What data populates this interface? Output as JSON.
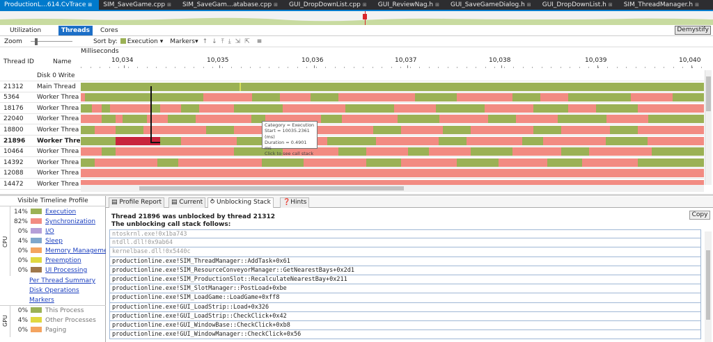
{
  "doc_tabs": [
    {
      "label": "ProductionL…614.CvTrace",
      "active": true
    },
    {
      "label": "SIM_SaveGame.cpp",
      "active": false
    },
    {
      "label": "SIM_SaveGam…atabase.cpp",
      "active": false
    },
    {
      "label": "GUI_DropDownList.cpp",
      "active": false
    },
    {
      "label": "GUI_ReviewNag.h",
      "active": false
    },
    {
      "label": "GUI_SaveGameDialog.h",
      "active": false
    },
    {
      "label": "GUI_DropDownList.h",
      "active": false
    },
    {
      "label": "SIM_ThreadManager.h",
      "active": false
    }
  ],
  "view_tabs": {
    "utilization": "Utilization",
    "threads": "Threads",
    "cores": "Cores",
    "demystify": "Demystify"
  },
  "toolbar": {
    "zoom": "Zoom",
    "sort_by": "Sort by:",
    "sort_value": "Execution",
    "markers": "Markers",
    "zoom_level": 0.1
  },
  "timeline": {
    "unit_label": "Milliseconds",
    "col_thread": "Thread ID",
    "col_name": "Name",
    "ticks": [
      "10,034",
      "10,035",
      "10,036",
      "10,037",
      "10,038",
      "10,039",
      "10,040"
    ]
  },
  "threads": [
    {
      "id": "",
      "name": "Disk 0 Write",
      "bold": false
    },
    {
      "id": "21312",
      "name": "Main Thread",
      "bold": false
    },
    {
      "id": "5364",
      "name": "Worker Threa",
      "bold": false
    },
    {
      "id": "18176",
      "name": "Worker Threa",
      "bold": false
    },
    {
      "id": "22040",
      "name": "Worker Threa",
      "bold": false
    },
    {
      "id": "18800",
      "name": "Worker Threa",
      "bold": false
    },
    {
      "id": "21896",
      "name": "Worker Threa",
      "bold": true
    },
    {
      "id": "10464",
      "name": "Worker Threa",
      "bold": false
    },
    {
      "id": "14392",
      "name": "Worker Threa",
      "bold": false
    },
    {
      "id": "12088",
      "name": "Worker Threa",
      "bold": false
    },
    {
      "id": "14472",
      "name": "Worker Threa",
      "bold": false
    }
  ],
  "tooltip": [
    "Category = Execution",
    "Start = 10035.2361 (ms)",
    "Duration = 0.4901 ms",
    "Click to see call stack"
  ],
  "profile": {
    "title": "Visible Timeline Profile",
    "cpu_label": "CPU",
    "gpu_label": "GPU",
    "cpu_items": [
      {
        "pct": "14%",
        "label": "Execution",
        "color": "#9bb155"
      },
      {
        "pct": "82%",
        "label": "Synchronization",
        "color": "#f28b82"
      },
      {
        "pct": "0%",
        "label": "I/O",
        "color": "#b59fd8"
      },
      {
        "pct": "4%",
        "label": "Sleep",
        "color": "#7fa7cc"
      },
      {
        "pct": "0%",
        "label": "Memory Management",
        "color": "#f4a460"
      },
      {
        "pct": "0%",
        "label": "Preemption",
        "color": "#e0d840"
      },
      {
        "pct": "0%",
        "label": "UI Processing",
        "color": "#a0784a"
      }
    ],
    "links": [
      "Per Thread Summary",
      "Disk Operations",
      "Markers"
    ],
    "gpu_items": [
      {
        "pct": "0%",
        "label": "This Process",
        "color": "#9bb155"
      },
      {
        "pct": "4%",
        "label": "Other Processes",
        "color": "#e0d840"
      },
      {
        "pct": "0%",
        "label": "Paging",
        "color": "#f4a460"
      }
    ]
  },
  "bottom_tabs": [
    "Profile Report",
    "Current",
    "Unblocking Stack",
    "Hints"
  ],
  "unblock": {
    "line1": "Thread 21896 was unblocked by thread 21312",
    "line2": "The unblocking call stack follows:",
    "copy": "Copy",
    "stack": [
      {
        "text": "ntoskrnl.exe!0x1ba743",
        "dim": true
      },
      {
        "text": "ntdll.dll!0x9ab64",
        "dim": true
      },
      {
        "text": "kernelbase.dll!0x5440c",
        "dim": true
      },
      {
        "text": "productionline.exe!SIM_ThreadManager::AddTask+0x61",
        "dim": false
      },
      {
        "text": "productionline.exe!SIM_ResourceConveyorManager::GetNearestBays+0x2d1",
        "dim": false
      },
      {
        "text": "productionline.exe!SIM_ProductionSlot::RecalculateNearestBay+0x211",
        "dim": false
      },
      {
        "text": "productionline.exe!SIM_SlotManager::PostLoad+0xbe",
        "dim": false
      },
      {
        "text": "productionline.exe!SIM_LoadGame::LoadGame+0xff8",
        "dim": false
      },
      {
        "text": "productionline.exe!GUI_LoadStrip::Load+0x326",
        "dim": false
      },
      {
        "text": "productionline.exe!GUI_LoadStrip::CheckClick+0x42",
        "dim": false
      },
      {
        "text": "productionline.exe!GUI_WindowBase::CheckClick+0xb8",
        "dim": false
      },
      {
        "text": "productionline.exe!GUI_WindowManager::CheckClick+0x56",
        "dim": false
      }
    ]
  }
}
